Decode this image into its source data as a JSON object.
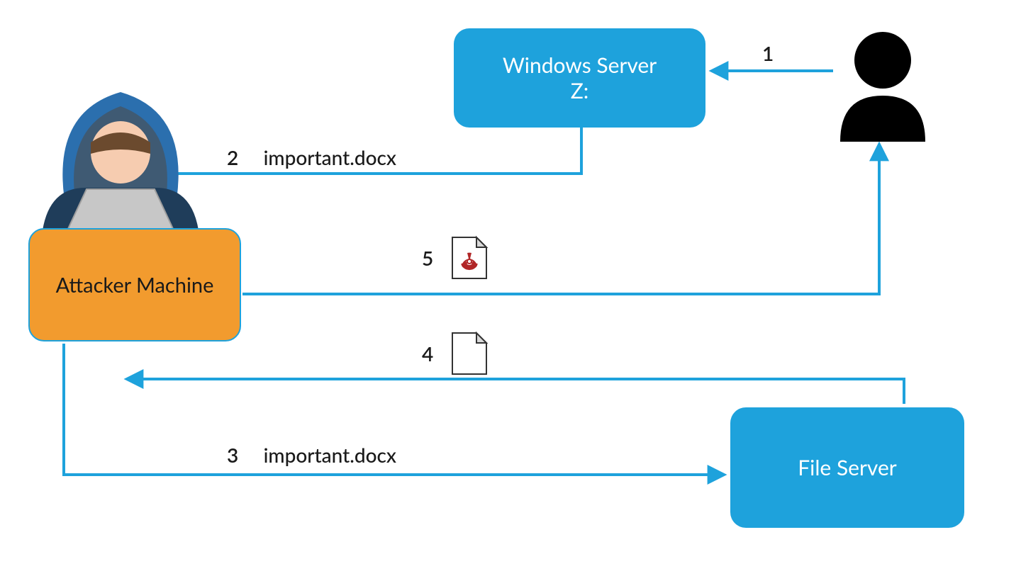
{
  "nodes": {
    "windows_server": {
      "line1": "Windows Server",
      "line2": "Z:"
    },
    "attacker": "Attacker Machine",
    "file_server": "File Server"
  },
  "steps": {
    "s1": "1",
    "s2_num": "2",
    "s2_text": "important.docx",
    "s3_num": "3",
    "s3_text": "important.docx",
    "s4": "4",
    "s5": "5"
  },
  "colors": {
    "blue": "#1ea2dc",
    "orange": "#f29b2e",
    "black": "#000000",
    "red": "#b12728"
  }
}
